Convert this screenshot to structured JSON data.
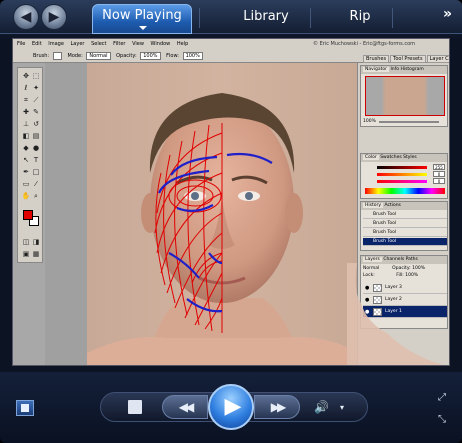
{
  "tabs": {
    "now_playing": "Now Playing",
    "library": "Library",
    "rip": "Rip",
    "more": "»"
  },
  "nav": {
    "back": "◀",
    "forward": "▶"
  },
  "photoshop": {
    "menu": [
      "File",
      "Edit",
      "Image",
      "Layer",
      "Select",
      "Filter",
      "View",
      "Window",
      "Help"
    ],
    "credit": "© Eric Muchowski - Eric@ftgs-forms.com",
    "options": {
      "brush_label": "Brush:",
      "mode_label": "Mode:",
      "mode_value": "Normal",
      "opacity_label": "Opacity:",
      "opacity_value": "100%",
      "flow_label": "Flow:",
      "flow_value": "100%"
    },
    "palette_tabs": [
      "Brushes",
      "Tool Presets",
      "Layer Comps"
    ],
    "navigator": {
      "tabs": [
        "Navigator",
        "Info",
        "Histogram"
      ],
      "zoom": "100%"
    },
    "color": {
      "tabs": [
        "Color",
        "Swatches",
        "Styles"
      ],
      "r": "255",
      "g": "0",
      "b": "0"
    },
    "history": {
      "tabs": [
        "History",
        "Actions"
      ],
      "items": [
        "Brush Tool",
        "Brush Tool",
        "Brush Tool",
        "Brush Tool"
      ]
    },
    "layers": {
      "tabs": [
        "Layers",
        "Channels",
        "Paths"
      ],
      "blend": "Normal",
      "opacity_label": "Opacity:",
      "opacity": "100%",
      "lock_label": "Lock:",
      "fill_label": "Fill:",
      "fill": "100%",
      "items": [
        "Layer 3",
        "Layer 2",
        "Layer 1"
      ]
    }
  },
  "controls": {
    "stop": "■",
    "rewind": "◀◀",
    "play": "▶",
    "fast_forward": "▶▶",
    "volume": "🔊",
    "volume_menu": "▾",
    "fullscreen": "⤢",
    "compact": "⤡"
  },
  "colors": {
    "active_tab": "#2f6fc6",
    "mesh_red": "#e00000",
    "mesh_blue": "#2020c8",
    "ps_gray": "#d4d0c8"
  }
}
